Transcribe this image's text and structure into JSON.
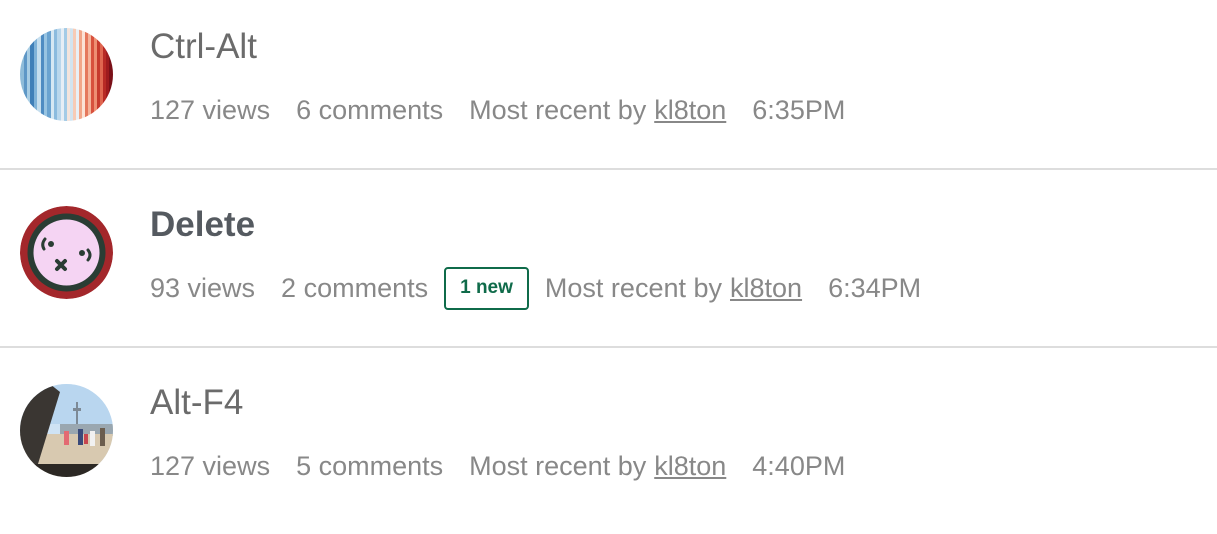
{
  "discussions": [
    {
      "title": "Ctrl-Alt",
      "views": "127 views",
      "comments": "6 comments",
      "new_count": "",
      "most_recent_label": "Most recent by",
      "most_recent_user": "kl8ton",
      "time": "6:35PM",
      "avatar": "stripes-avatar"
    },
    {
      "title": "Delete",
      "views": "93 views",
      "comments": "2 comments",
      "new_count": "1 new",
      "most_recent_label": "Most recent by",
      "most_recent_user": "kl8ton",
      "time": "6:34PM",
      "avatar": "face-avatar"
    },
    {
      "title": "Alt-F4",
      "views": "127 views",
      "comments": "5 comments",
      "new_count": "",
      "most_recent_label": "Most recent by",
      "most_recent_user": "kl8ton",
      "time": "4:40PM",
      "avatar": "photo-avatar"
    }
  ],
  "colors": {
    "new_badge": "#0f6b4a",
    "divider": "#dddddd",
    "meta_text": "#888888"
  }
}
